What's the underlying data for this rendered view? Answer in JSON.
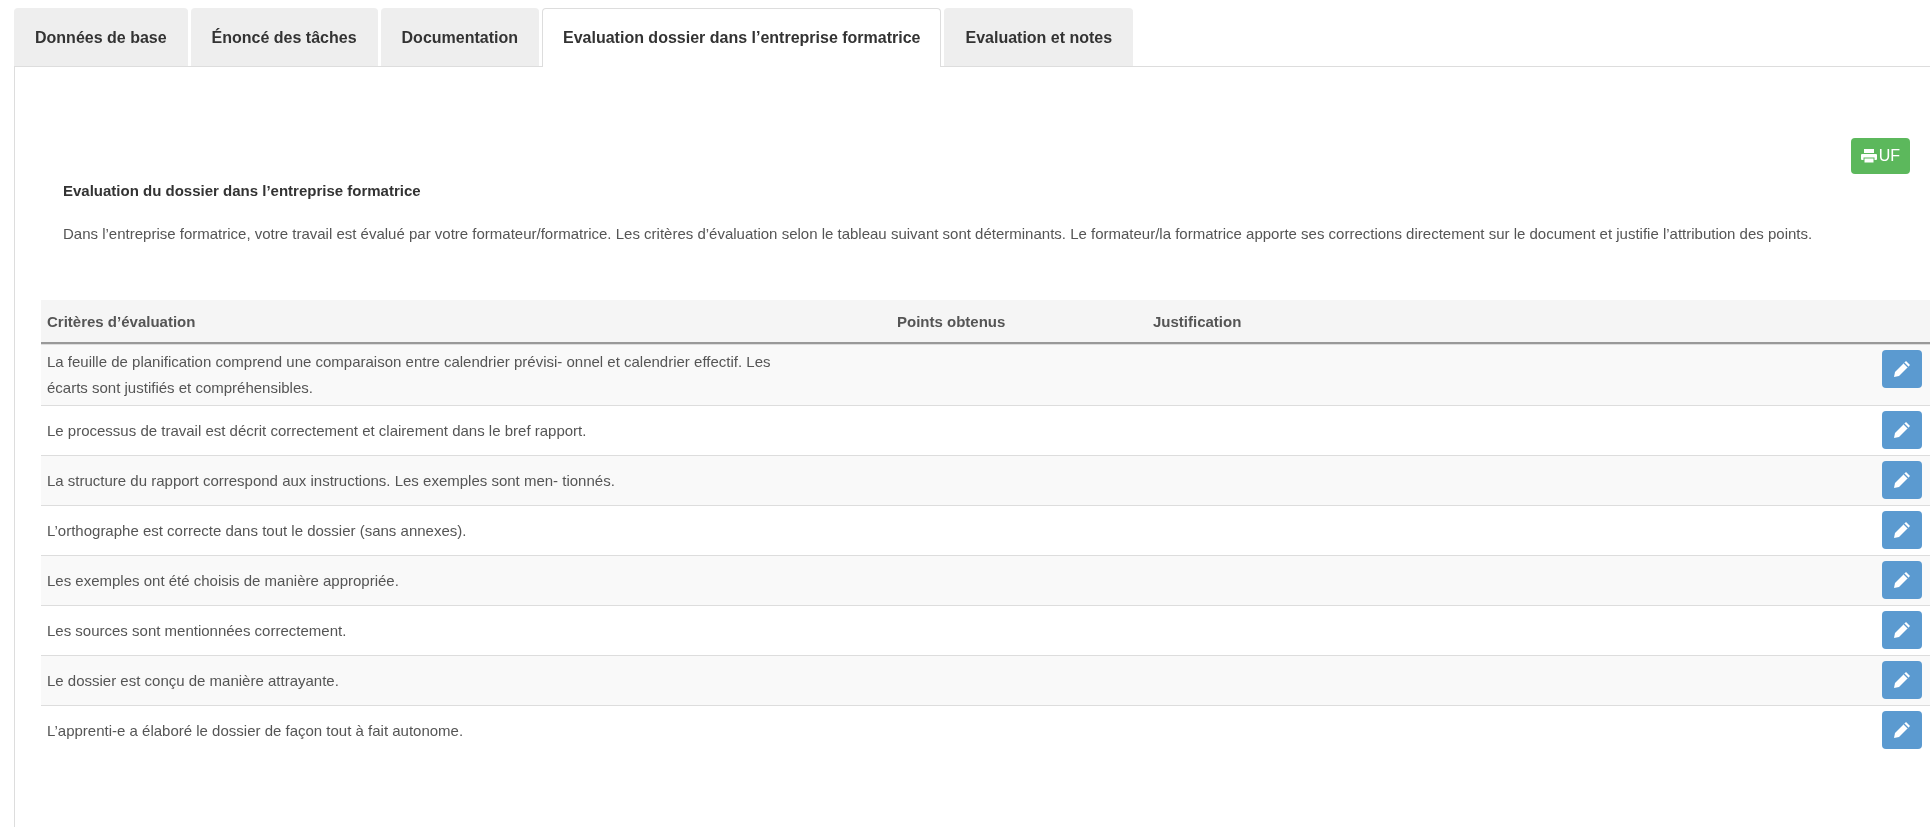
{
  "tabs": [
    {
      "label": "Données de base",
      "selected": false
    },
    {
      "label": "Énoncé des tâches",
      "selected": false
    },
    {
      "label": "Documentation",
      "selected": false
    },
    {
      "label": "Evaluation dossier dans l’entreprise formatrice",
      "selected": true
    },
    {
      "label": "Evaluation et notes",
      "selected": false
    }
  ],
  "print_button": {
    "label": "UF"
  },
  "section": {
    "title": "Evaluation du dossier dans l’entreprise formatrice",
    "text": "Dans l’entreprise formatrice, votre travail est évalué par votre formateur/formatrice. Les critères d’évaluation selon le tableau suivant sont déterminants. Le formateur/la formatrice apporte ses corrections directement sur le document et justifie l’attribution des points."
  },
  "table": {
    "columns": [
      "Critères d’évaluation",
      "Points obtenus",
      "Justification"
    ],
    "rows": [
      {
        "criterion": "La feuille de planification comprend une comparaison entre calendrier prévisi- onnel et calendrier effectif. Les écarts sont justifiés et compréhensibles."
      },
      {
        "criterion": "Le processus de travail est décrit correctement et clairement dans le bref rapport."
      },
      {
        "criterion": "La structure du rapport correspond aux instructions. Les exemples sont men- tionnés."
      },
      {
        "criterion": "L’orthographe est correcte dans tout le dossier (sans annexes)."
      },
      {
        "criterion": "Les exemples ont été choisis de manière appropriée."
      },
      {
        "criterion": "Les sources sont mentionnées correctement."
      },
      {
        "criterion": "Le dossier est conçu de manière attrayante."
      },
      {
        "criterion": "L’apprenti-e a élaboré le dossier de façon tout à fait autonome."
      }
    ]
  }
}
